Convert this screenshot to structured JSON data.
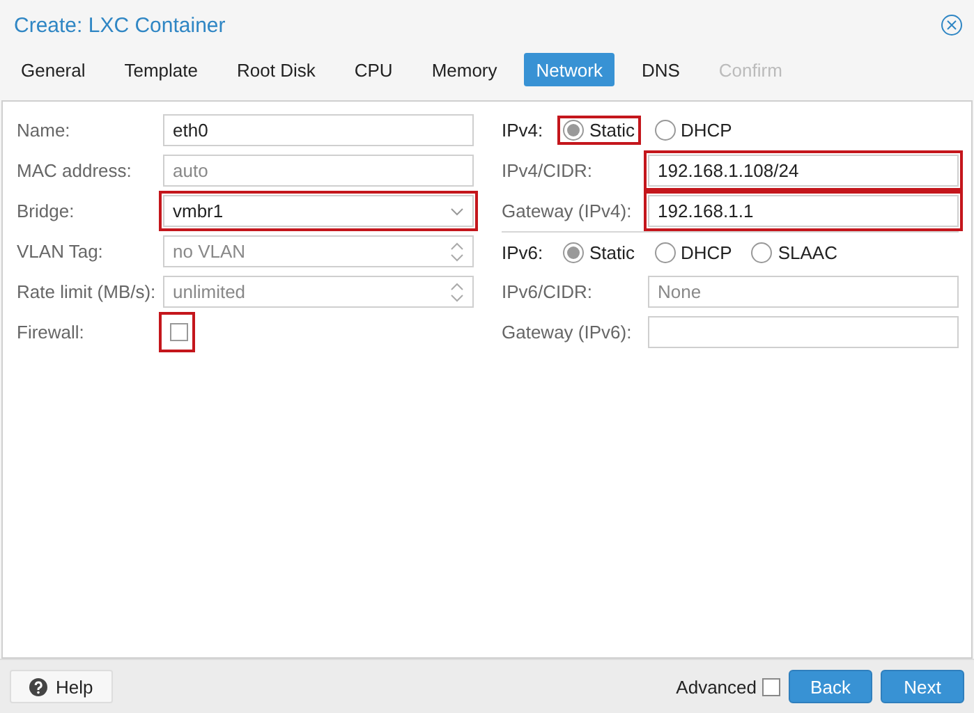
{
  "window": {
    "title": "Create: LXC Container"
  },
  "tabs": [
    {
      "label": "General",
      "selected": false,
      "disabled": false
    },
    {
      "label": "Template",
      "selected": false,
      "disabled": false
    },
    {
      "label": "Root Disk",
      "selected": false,
      "disabled": false
    },
    {
      "label": "CPU",
      "selected": false,
      "disabled": false
    },
    {
      "label": "Memory",
      "selected": false,
      "disabled": false
    },
    {
      "label": "Network",
      "selected": true,
      "disabled": false
    },
    {
      "label": "DNS",
      "selected": false,
      "disabled": false
    },
    {
      "label": "Confirm",
      "selected": false,
      "disabled": true
    }
  ],
  "left_fields": [
    {
      "label": "Name:",
      "kind": "text",
      "value": "eth0",
      "highlighted": false
    },
    {
      "label": "MAC address:",
      "kind": "text",
      "placeholder": "auto",
      "highlighted": false
    },
    {
      "label": "Bridge:",
      "kind": "combo",
      "value": "vmbr1",
      "highlighted": true
    },
    {
      "label": "VLAN Tag:",
      "kind": "spinner",
      "placeholder": "no VLAN",
      "highlighted": false
    },
    {
      "label": "Rate limit (MB/s):",
      "kind": "spinner",
      "placeholder": "unlimited",
      "highlighted": false
    },
    {
      "label": "Firewall:",
      "kind": "checkbox",
      "checked": false,
      "highlighted": true
    }
  ],
  "right_fields": [
    {
      "label": "IPv4:",
      "kind": "radio",
      "options": [
        {
          "label": "Static",
          "selected": true,
          "highlighted": true
        },
        {
          "label": "DHCP",
          "selected": false,
          "highlighted": false
        }
      ]
    },
    {
      "label": "IPv4/CIDR:",
      "kind": "text",
      "value": "192.168.1.108/24",
      "highlighted": true
    },
    {
      "label": "Gateway (IPv4):",
      "kind": "text",
      "value": "192.168.1.1",
      "highlighted": true
    },
    {
      "label": "IPv6:",
      "kind": "radio",
      "options": [
        {
          "label": "Static",
          "selected": true,
          "highlighted": false
        },
        {
          "label": "DHCP",
          "selected": false,
          "highlighted": false
        },
        {
          "label": "SLAAC",
          "selected": false,
          "highlighted": false
        }
      ]
    },
    {
      "label": "IPv6/CIDR:",
      "kind": "text",
      "placeholder": "None",
      "highlighted": false
    },
    {
      "label": "Gateway (IPv6):",
      "kind": "text",
      "highlighted": false
    }
  ],
  "footer": {
    "help": "Help",
    "advanced": {
      "label": "Advanced",
      "checked": false
    },
    "buttons": [
      "Back",
      "Next"
    ]
  }
}
